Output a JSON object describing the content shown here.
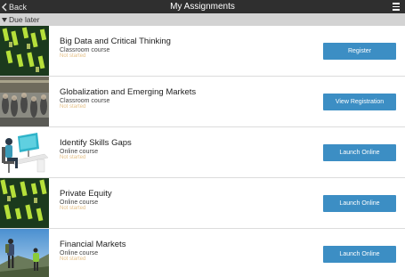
{
  "header": {
    "back_label": "Back",
    "title": "My Assignments",
    "menu_icon": "hamburger-menu-icon"
  },
  "section": {
    "label": "Due later"
  },
  "assignments": [
    {
      "title": "Big Data and Critical Thinking",
      "type": "Classroom course",
      "status": "Not started",
      "action": "Register",
      "image": "green-stock-ticker"
    },
    {
      "title": "Globalization and Emerging Markets",
      "type": "Classroom course",
      "status": "Not started",
      "action": "View Registration",
      "image": "crowd-at-station"
    },
    {
      "title": "Identify Skills Gaps",
      "type": "Online course",
      "status": "Not started",
      "action": "Launch Online",
      "image": "person-at-computer"
    },
    {
      "title": "Private Equity",
      "type": "Online course",
      "status": "Not started",
      "action": "Launch Online",
      "image": "green-stock-ticker"
    },
    {
      "title": "Financial Markets",
      "type": "Online course",
      "status": "Not started",
      "action": "Launch Online",
      "image": "hikers-on-mountain"
    }
  ],
  "colors": {
    "header_bg": "#2f2f2f",
    "section_bg": "#d3d3d3",
    "button_bg": "#3c8ec4",
    "status_text": "#e6c28a"
  }
}
